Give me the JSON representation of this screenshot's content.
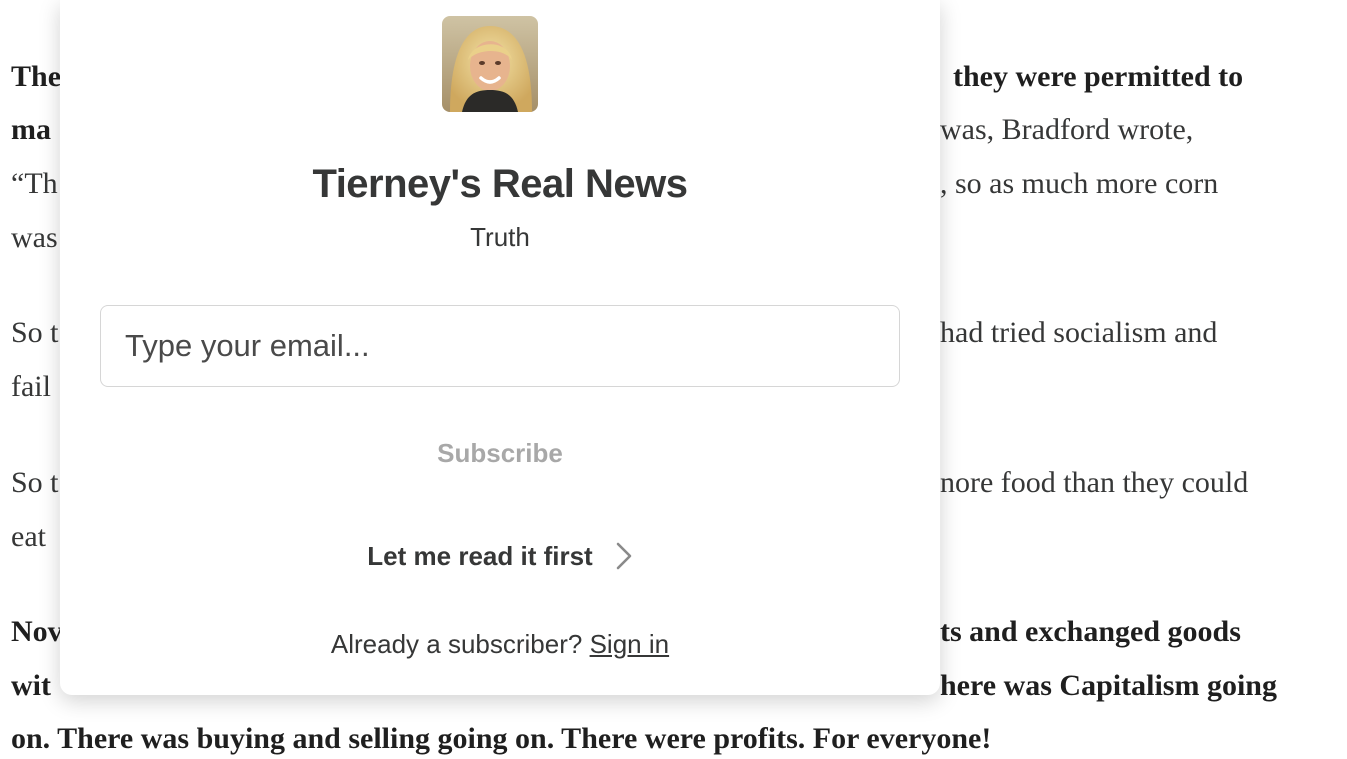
{
  "article": {
    "lines": [
      {
        "pre": "The",
        "bold_pre": true,
        "post": "they were permitted to",
        "bold_post": true
      },
      {
        "pre": "ma",
        "bold_pre": true,
        "post": "was, Bradford wrote,",
        "bold_post": false
      },
      {
        "pre": "“Th",
        "bold_pre": false,
        "post": ", so as much more corn",
        "bold_post": false
      },
      {
        "pre": "was",
        "bold_pre": false,
        "post": "",
        "bold_post": false
      },
      {
        "pre": "So t",
        "bold_pre": false,
        "post": "had tried socialism and",
        "bold_post": false
      },
      {
        "pre": "fail",
        "bold_pre": false,
        "post": "",
        "bold_post": false
      },
      {
        "pre": "So t",
        "bold_pre": false,
        "post": "nore food than they could",
        "bold_post": false
      },
      {
        "pre": "eat",
        "bold_pre": false,
        "post": "",
        "bold_post": false
      },
      {
        "pre": "Nov",
        "bold_pre": true,
        "post": "ts and exchanged goods",
        "bold_post": true
      },
      {
        "pre": "wit",
        "bold_pre": true,
        "post": "here was Capitalism going",
        "bold_post": true
      },
      {
        "full": "on. There was buying and selling going on. There were profits. For everyone!",
        "bold": true
      }
    ]
  },
  "modal": {
    "avatar_alt": "avatar",
    "title": "Tierney's Real News",
    "subtitle": "Truth",
    "email_placeholder": "Type your email...",
    "subscribe_label": "Subscribe",
    "read_first_label": "Let me read it first",
    "already_text": "Already a subscriber?",
    "sign_in_label": "Sign in"
  },
  "colors": {
    "text": "#363737",
    "muted_button": "#a8a8a8",
    "border": "#d6d6d6"
  },
  "icons": {
    "read_first": "chevron-right-icon"
  }
}
